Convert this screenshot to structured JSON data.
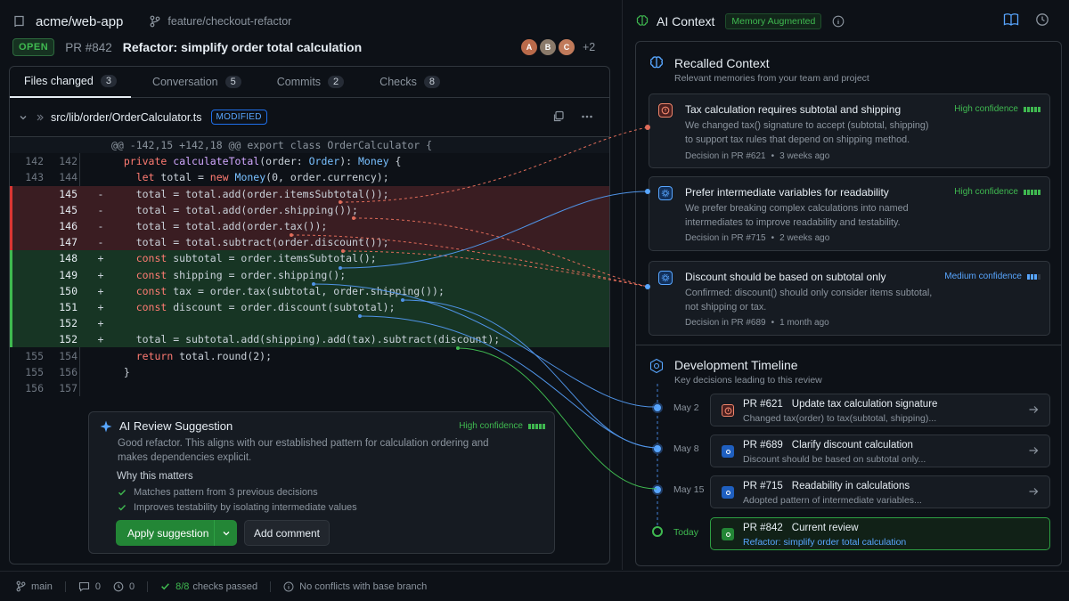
{
  "repo": {
    "name": "acme/web-app",
    "branch": "feature/checkout-refactor"
  },
  "pr": {
    "status": "OPEN",
    "number": "PR #842",
    "title": "Refactor: simplify order total calculation",
    "avatars": [
      "A",
      "B",
      "C"
    ],
    "more": "+2"
  },
  "tabs": [
    {
      "label": "Files changed",
      "count": "3"
    },
    {
      "label": "Conversation",
      "count": "5"
    },
    {
      "label": "Commits",
      "count": "2"
    },
    {
      "label": "Checks",
      "count": "8"
    }
  ],
  "file": {
    "path": "src/lib/order/OrderCalculator.ts",
    "badge": "MODIFIED"
  },
  "diff": {
    "hunk": "@@ -142,15 +142,18 @@ export class OrderCalculator {",
    "lines": [
      {
        "o": "142",
        "n": "142",
        "s": "",
        "t": "ctx",
        "c": "  private calculateTotal(order: Order): Money {"
      },
      {
        "o": "143",
        "n": "144",
        "s": "",
        "t": "ctx",
        "c": "    let total = new Money(0, order.currency);"
      },
      {
        "o": "",
        "n": "145",
        "s": "-",
        "t": "del",
        "c": "    total = total.add(order.itemsSubtotal());"
      },
      {
        "o": "",
        "n": "145",
        "s": "-",
        "t": "del",
        "c": "    total = total.add(order.shipping());"
      },
      {
        "o": "",
        "n": "146",
        "s": "-",
        "t": "del",
        "c": "    total = total.add(order.tax());"
      },
      {
        "o": "",
        "n": "147",
        "s": "-",
        "t": "del",
        "c": "    total = total.subtract(order.discount());"
      },
      {
        "o": "",
        "n": "148",
        "s": "+",
        "t": "add",
        "c": "    const subtotal = order.itemsSubtotal();"
      },
      {
        "o": "",
        "n": "149",
        "s": "+",
        "t": "add",
        "c": "    const shipping = order.shipping();"
      },
      {
        "o": "",
        "n": "150",
        "s": "+",
        "t": "add",
        "c": "    const tax = order.tax(subtotal, order.shipping());"
      },
      {
        "o": "",
        "n": "151",
        "s": "+",
        "t": "add",
        "c": "    const discount = order.discount(subtotal);"
      },
      {
        "o": "",
        "n": "152",
        "s": "+",
        "t": "add",
        "c": ""
      },
      {
        "o": "",
        "n": "152",
        "s": "+",
        "t": "add",
        "c": "    total = subtotal.add(shipping).add(tax).subtract(discount);"
      },
      {
        "o": "155",
        "n": "154",
        "s": "",
        "t": "ctx",
        "c": "    return total.round(2);"
      },
      {
        "o": "155",
        "n": "156",
        "s": "",
        "t": "ctx",
        "c": "  }"
      },
      {
        "o": "156",
        "n": "157",
        "s": "",
        "t": "ctx",
        "c": ""
      }
    ]
  },
  "suggestion": {
    "title": "AI Review Suggestion",
    "confidence": "High confidence",
    "body": "Good refactor. This aligns with our established pattern for calculation ordering and makes dependencies explicit.",
    "why_title": "Why this matters",
    "points": [
      "Matches pattern from 3 previous decisions",
      "Improves testability by isolating intermediate values"
    ],
    "apply_label": "Apply suggestion",
    "comment_label": "Add comment"
  },
  "ai_context": {
    "title": "AI Context",
    "badge": "Memory Augmented"
  },
  "recalled": {
    "title": "Recalled Context",
    "subtitle": "Relevant memories from your team and project",
    "memories": [
      {
        "title": "Tax calculation requires subtotal and shipping",
        "desc": "We changed tax() signature to accept (subtotal, shipping) to support tax rules that depend on shipping method.",
        "source": "Decision in PR #621",
        "age": "3 weeks ago",
        "confidence": "High confidence",
        "level": "high",
        "color": "#f0856b"
      },
      {
        "title": "Prefer intermediate variables for readability",
        "desc": "We prefer breaking complex calculations into named intermediates to improve readability and testability.",
        "source": "Decision in PR #715",
        "age": "2 weeks ago",
        "confidence": "High confidence",
        "level": "high",
        "color": "#58a6ff"
      },
      {
        "title": "Discount should be based on subtotal only",
        "desc": "Confirmed: discount() should only consider items subtotal, not shipping or tax.",
        "source": "Decision in PR #689",
        "age": "1 month ago",
        "confidence": "Medium confidence",
        "level": "med",
        "color": "#58a6ff"
      }
    ]
  },
  "timeline": {
    "title": "Development Timeline",
    "subtitle": "Key decisions leading to this review",
    "items": [
      {
        "date": "May 2",
        "pr": "PR #621",
        "title": "Update tax calculation signature",
        "sub": "Changed tax(order) to tax(subtotal, shipping)...",
        "color": "#f0856b"
      },
      {
        "date": "May 8",
        "pr": "PR #689",
        "title": "Clarify discount calculation",
        "sub": "Discount should be based on subtotal only...",
        "color": "#58a6ff"
      },
      {
        "date": "May 15",
        "pr": "PR #715",
        "title": "Readability in calculations",
        "sub": "Adopted pattern of intermediate variables...",
        "color": "#58a6ff"
      },
      {
        "date": "Today",
        "pr": "PR #842",
        "title": "Current review",
        "sub": "Refactor: simplify order total calculation",
        "color": "#3fb950"
      }
    ]
  },
  "footer": {
    "branch": "main",
    "comments": "0",
    "reviews": "0",
    "checks_count": "8/8",
    "checks_label": "checks passed",
    "conflicts": "No conflicts with base branch"
  }
}
